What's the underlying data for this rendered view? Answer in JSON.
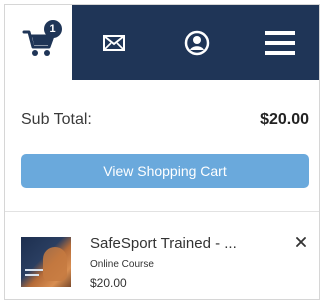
{
  "header": {
    "cart_badge_count": "1",
    "nav_icons": [
      "cart-icon",
      "mail-icon",
      "account-icon",
      "menu-icon"
    ],
    "nav_background": "#1f3557"
  },
  "summary": {
    "subtotal_label": "Sub Total:",
    "subtotal_value": "$20.00"
  },
  "actions": {
    "view_cart_label": "View Shopping Cart",
    "button_color": "#6aa9dc"
  },
  "cart_items": [
    {
      "title": "SafeSport Trained - ...",
      "type": "Online Course",
      "price": "$20.00",
      "remove_icon": "close-icon"
    }
  ]
}
